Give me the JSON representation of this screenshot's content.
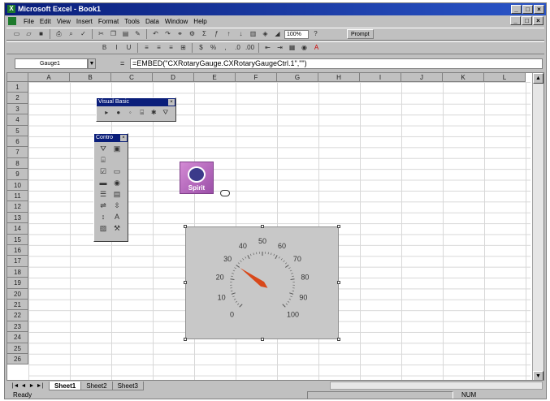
{
  "window": {
    "title": "Microsoft Excel - Book1",
    "app_icon": "excel-icon"
  },
  "menu": {
    "items": [
      "File",
      "Edit",
      "View",
      "Insert",
      "Format",
      "Tools",
      "Data",
      "Window",
      "Help"
    ]
  },
  "toolbar": {
    "zoom": "100%",
    "prompt_label": "Prompt"
  },
  "formula_bar": {
    "name_box": "Gauge1",
    "equals": "=",
    "formula": "=EMBED(\"CXRotaryGauge.CXRotaryGaugeCtrl.1\",\"\")"
  },
  "grid": {
    "columns": [
      "A",
      "B",
      "C",
      "D",
      "E",
      "F",
      "G",
      "H",
      "I",
      "J",
      "K",
      "L"
    ],
    "rows": [
      "1",
      "2",
      "3",
      "4",
      "5",
      "6",
      "7",
      "8",
      "9",
      "10",
      "11",
      "12",
      "13",
      "14",
      "15",
      "16",
      "17",
      "18",
      "19",
      "20",
      "21",
      "22",
      "23",
      "24",
      "25",
      "26"
    ]
  },
  "vb_toolbar": {
    "title": "Visual Basic"
  },
  "controls_toolbar": {
    "title": "Contro"
  },
  "image_control": {
    "label": "Spirit"
  },
  "gauge": {
    "min": 0,
    "max": 100,
    "value": 30,
    "tick_labels": [
      "0",
      "10",
      "20",
      "30",
      "40",
      "50",
      "60",
      "70",
      "80",
      "90",
      "100"
    ],
    "needle_color": "#d8481a",
    "face_color": "#c8c8c8"
  },
  "sheets": {
    "tabs": [
      "Sheet1",
      "Sheet2",
      "Sheet3"
    ],
    "active": "Sheet1"
  },
  "status": {
    "left": "Ready",
    "num": "NUM"
  },
  "colors": {
    "title_bar": "#0a1e7a",
    "chrome": "#c0c0c0"
  }
}
